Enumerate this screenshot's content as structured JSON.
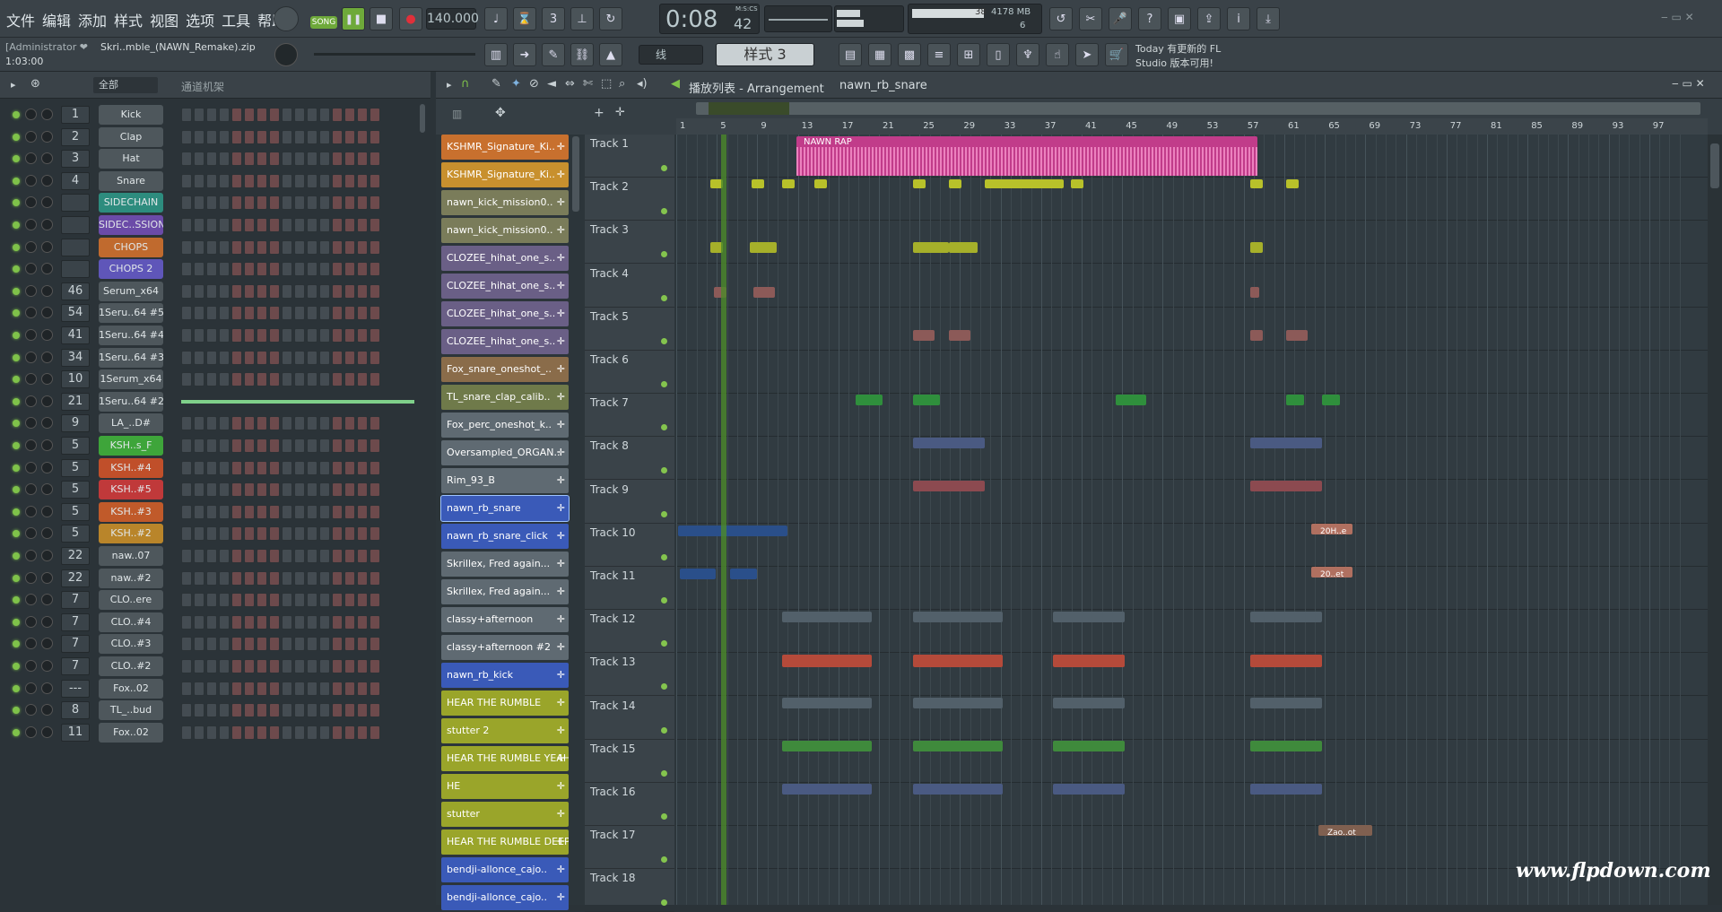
{
  "menu": [
    "文件",
    "编辑",
    "添加",
    "样式",
    "视图",
    "选项",
    "工具",
    "帮助"
  ],
  "transport": {
    "mode": "SONG",
    "tempo": "140.000",
    "time": "0:08",
    "time_sub": "42",
    "time_unit": "M:S:CS"
  },
  "memory": {
    "label": "4178 MB",
    "value": "38",
    "count": "6"
  },
  "project": {
    "user": "[Administrator ❤",
    "file": "Skri..mble_(NAWN_Remake).zip",
    "time": "1:03:00"
  },
  "pattern": {
    "snap": "线",
    "name": "样式 3"
  },
  "news": {
    "line1": "Today 有更新的 FL",
    "line2": "Studio 版本可用!"
  },
  "rack": {
    "filter": "全部",
    "title": "通道机架"
  },
  "channels": [
    {
      "num": "1",
      "name": "Kick",
      "color": "#4e575c"
    },
    {
      "num": "2",
      "name": "Clap",
      "color": "#4e575c"
    },
    {
      "num": "3",
      "name": "Hat",
      "color": "#4e575c"
    },
    {
      "num": "4",
      "name": "Snare",
      "color": "#4e575c"
    },
    {
      "num": "",
      "name": "SIDECHAIN",
      "color": "#2d8c7e"
    },
    {
      "num": "",
      "name": "SIDEC..SSION",
      "color": "#6b4ba8"
    },
    {
      "num": "",
      "name": "CHOPS",
      "color": "#c06a2e"
    },
    {
      "num": "",
      "name": "CHOPS 2",
      "color": "#5f56b9"
    },
    {
      "num": "46",
      "name": "Serum_x64",
      "color": "#4e575c"
    },
    {
      "num": "54",
      "name": "1Seru..64 #5",
      "color": "#4e575c"
    },
    {
      "num": "41",
      "name": "1Seru..64 #4",
      "color": "#4e575c"
    },
    {
      "num": "34",
      "name": "1Seru..64 #3",
      "color": "#4e575c"
    },
    {
      "num": "10",
      "name": "1Serum_x64",
      "color": "#4e575c"
    },
    {
      "num": "21",
      "name": "1Seru..64 #2",
      "color": "#4e575c"
    },
    {
      "num": "9",
      "name": "LA_..D#",
      "color": "#4e575c"
    },
    {
      "num": "5",
      "name": "KSH..s_F",
      "color": "#3ea53a"
    },
    {
      "num": "5",
      "name": "KSH..#4",
      "color": "#c04f2a"
    },
    {
      "num": "5",
      "name": "KSH..#5",
      "color": "#c0393a"
    },
    {
      "num": "5",
      "name": "KSH..#3",
      "color": "#c05a2a"
    },
    {
      "num": "5",
      "name": "KSH..#2",
      "color": "#b9852a"
    },
    {
      "num": "22",
      "name": "naw..07",
      "color": "#4e575c"
    },
    {
      "num": "22",
      "name": "naw..#2",
      "color": "#4e575c"
    },
    {
      "num": "7",
      "name": "CLO..ere",
      "color": "#4e575c"
    },
    {
      "num": "7",
      "name": "CLO..#4",
      "color": "#4e575c"
    },
    {
      "num": "7",
      "name": "CLO..#3",
      "color": "#4e575c"
    },
    {
      "num": "7",
      "name": "CLO..#2",
      "color": "#4e575c"
    },
    {
      "num": "---",
      "name": "Fox..02",
      "color": "#4e575c"
    },
    {
      "num": "8",
      "name": "TL_..bud",
      "color": "#4e575c"
    },
    {
      "num": "11",
      "name": "Fox..02",
      "color": "#4e575c"
    }
  ],
  "playlist": {
    "title": "播放列表 - Arrangement",
    "crumb": "nawn_rb_snare"
  },
  "ruler": [
    "1",
    "5",
    "9",
    "13",
    "17",
    "21",
    "25",
    "29",
    "33",
    "37",
    "41",
    "45",
    "49",
    "53",
    "57",
    "61",
    "65",
    "69",
    "73",
    "77",
    "81",
    "85",
    "89",
    "93",
    "97"
  ],
  "patterns": [
    {
      "name": "KSHMR_Signature_Ki..",
      "color": "#c8702e"
    },
    {
      "name": "KSHMR_Signature_Ki..",
      "color": "#c8902e"
    },
    {
      "name": "nawn_kick_mission0..",
      "color": "#7a7c5a"
    },
    {
      "name": "nawn_kick_mission0..",
      "color": "#7a7c5a"
    },
    {
      "name": "CLOZEE_hihat_one_s..",
      "color": "#6a5f86"
    },
    {
      "name": "CLOZEE_hihat_one_s..",
      "color": "#6a5f86"
    },
    {
      "name": "CLOZEE_hihat_one_s..",
      "color": "#6a5f86"
    },
    {
      "name": "CLOZEE_hihat_one_s..",
      "color": "#6a5f86"
    },
    {
      "name": "Fox_snare_oneshot_..",
      "color": "#8a6c4a"
    },
    {
      "name": "TL_snare_clap_calib..",
      "color": "#6f7a4a"
    },
    {
      "name": "Fox_perc_oneshot_k..",
      "color": "#5f6a72"
    },
    {
      "name": "Oversampled_ORGAN..",
      "color": "#5f6a72"
    },
    {
      "name": "Rim_93_B",
      "color": "#5f6a72"
    },
    {
      "name": "nawn_rb_snare",
      "color": "#3a5ab8"
    },
    {
      "name": "nawn_rb_snare_click",
      "color": "#3a5ab8"
    },
    {
      "name": "Skrillex, Fred again...",
      "color": "#5f6a72"
    },
    {
      "name": "Skrillex, Fred again...",
      "color": "#5f6a72"
    },
    {
      "name": "classy+afternoon",
      "color": "#5f6a72"
    },
    {
      "name": "classy+afternoon #2",
      "color": "#5f6a72"
    },
    {
      "name": "nawn_rb_kick",
      "color": "#3a5ab8"
    },
    {
      "name": "HEAR THE RUMBLE",
      "color": "#9aa52a"
    },
    {
      "name": "stutter 2",
      "color": "#9aa52a"
    },
    {
      "name": "HEAR THE RUMBLE YEAH..",
      "color": "#9aa52a"
    },
    {
      "name": "HE",
      "color": "#9aa52a"
    },
    {
      "name": "stutter",
      "color": "#9aa52a"
    },
    {
      "name": "HEAR THE RUMBLE DEEP",
      "color": "#9aa52a"
    },
    {
      "name": "bendji-allonce_cajo..",
      "color": "#3a5ab8"
    },
    {
      "name": "bendji-allonce_cajo..",
      "color": "#3a5ab8"
    }
  ],
  "tracks": [
    "Track 1",
    "Track 2",
    "Track 3",
    "Track 4",
    "Track 5",
    "Track 6",
    "Track 7",
    "Track 8",
    "Track 9",
    "Track 10",
    "Track 11",
    "Track 12",
    "Track 13",
    "Track 14",
    "Track 15",
    "Track 16",
    "Track 17",
    "Track 18"
  ],
  "clips": {
    "track1": "NAWN RAP",
    "t12": "20H..e",
    "t13": "20..et",
    "t18": "Zao..ot"
  },
  "watermark": "www.flpdown.com"
}
